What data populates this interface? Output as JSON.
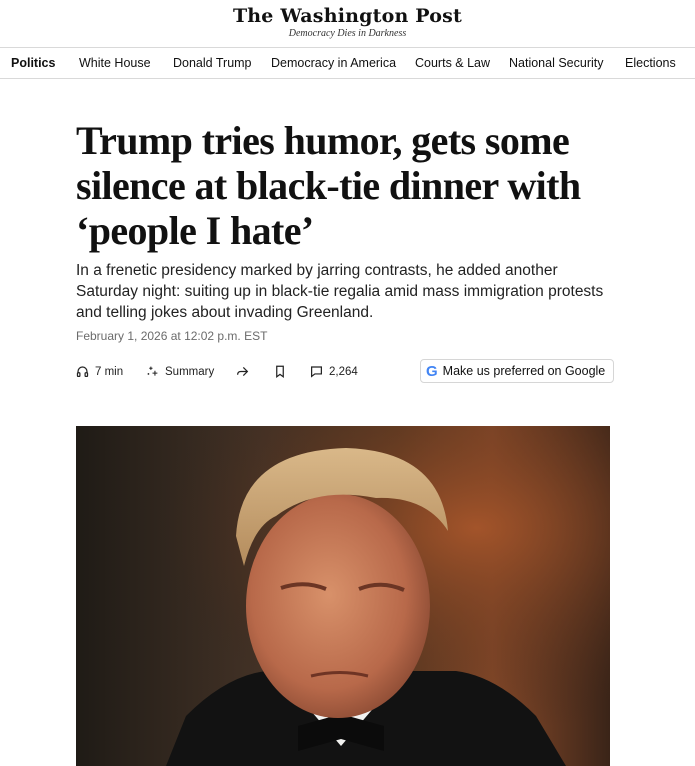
{
  "masthead": {
    "logo": "The Washington Post",
    "tagline": "Democracy Dies in Darkness"
  },
  "nav": {
    "items": [
      {
        "label": "Politics",
        "active": true
      },
      {
        "label": "White House"
      },
      {
        "label": "Donald Trump"
      },
      {
        "label": "Democracy in America"
      },
      {
        "label": "Courts & Law"
      },
      {
        "label": "National Security"
      },
      {
        "label": "Elections"
      }
    ]
  },
  "article": {
    "headline": "Trump tries humor, gets some silence at black-tie dinner with ‘people I hate’",
    "dek": "In a frenetic presidency marked by jarring contrasts, he added another Saturday night: suiting up in black-tie regalia amid mass immigration protests and telling jokes about invading Greenland.",
    "date": "February 1, 2026 at 12:02 p.m. EST"
  },
  "tools": {
    "listen_label": "7 min",
    "summary_label": "Summary",
    "comments_count": "2,264",
    "google_g": "G",
    "google_label": "Make us preferred on Google"
  },
  "icons": {
    "listen": "headphones-icon",
    "summary": "sparkle-icon",
    "share": "share-icon",
    "save": "bookmark-icon",
    "comments": "comment-icon"
  },
  "colors": {
    "text": "#111111",
    "meta": "#6b6b6b",
    "rule": "#d9d9d9",
    "google_blue": "#4285F4"
  }
}
